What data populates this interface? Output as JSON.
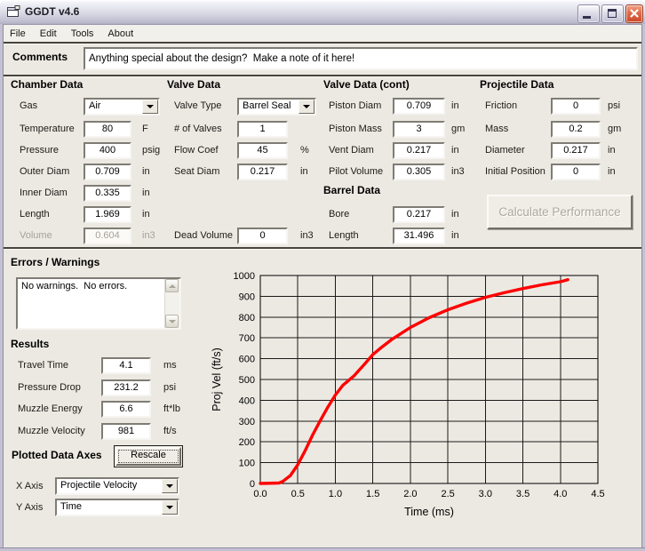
{
  "window": {
    "title": "GGDT v4.6",
    "menu": [
      "File",
      "Edit",
      "Tools",
      "About"
    ]
  },
  "comments": {
    "label": "Comments",
    "value": "Anything special about the design?  Make a note of it here!"
  },
  "columns": [
    {
      "id": "chamber-data",
      "heading": "Chamber Data",
      "fields": [
        {
          "row": 0,
          "label": "Gas",
          "type": "dropdown",
          "value": "Air",
          "unit": ""
        },
        {
          "row": 1,
          "label": "Temperature",
          "type": "text",
          "value": "80",
          "unit": "F"
        },
        {
          "row": 2,
          "label": "Pressure",
          "type": "text",
          "value": "400",
          "unit": "psig"
        },
        {
          "row": 3,
          "label": "Outer Diam",
          "type": "text",
          "value": "0.709",
          "unit": "in"
        },
        {
          "row": 4,
          "label": "Inner Diam",
          "type": "text",
          "value": "0.335",
          "unit": "in"
        },
        {
          "row": 5,
          "label": "Length",
          "type": "text",
          "value": "1.969",
          "unit": "in"
        },
        {
          "row": 6,
          "label": "Volume",
          "type": "text-disabled",
          "value": "0.604",
          "unit": "in3"
        }
      ]
    },
    {
      "id": "valve-data",
      "heading": "Valve Data",
      "fields": [
        {
          "row": 0,
          "label": "Valve Type",
          "type": "dropdown",
          "value": "Barrel Seal",
          "unit": ""
        },
        {
          "row": 1,
          "label": "# of Valves",
          "type": "text",
          "value": "1",
          "unit": ""
        },
        {
          "row": 2,
          "label": "Flow Coef",
          "type": "text",
          "value": "45",
          "unit": "%"
        },
        {
          "row": 3,
          "label": "Seat Diam",
          "type": "text",
          "value": "0.217",
          "unit": "in"
        },
        {
          "row": 6,
          "label": "Dead Volume",
          "type": "text",
          "value": "0",
          "unit": "in3"
        }
      ]
    },
    {
      "id": "valve-data-cont",
      "heading": "Valve Data (cont)",
      "subheading": "Barrel Data",
      "fields": [
        {
          "row": 0,
          "label": "Piston Diam",
          "type": "text",
          "value": "0.709",
          "unit": "in"
        },
        {
          "row": 1,
          "label": "Piston Mass",
          "type": "text",
          "value": "3",
          "unit": "gm"
        },
        {
          "row": 2,
          "label": "Vent Diam",
          "type": "text",
          "value": "0.217",
          "unit": "in"
        },
        {
          "row": 3,
          "label": "Pilot Volume",
          "type": "text",
          "value": "0.305",
          "unit": "in3"
        },
        {
          "row": 5,
          "label": "Bore",
          "type": "text",
          "value": "0.217",
          "unit": "in"
        },
        {
          "row": 6,
          "label": "Length",
          "type": "text",
          "value": "31.496",
          "unit": "in"
        }
      ]
    },
    {
      "id": "projectile-data",
      "heading": "Projectile Data",
      "button": "Calculate Performance",
      "fields": [
        {
          "row": 0,
          "label": "Friction",
          "type": "text",
          "value": "0",
          "unit": "psi"
        },
        {
          "row": 1,
          "label": "Mass",
          "type": "text",
          "value": "0.2",
          "unit": "gm"
        },
        {
          "row": 2,
          "label": "Diameter",
          "type": "text",
          "value": "0.217",
          "unit": "in"
        },
        {
          "row": 3,
          "label": "Initial Position",
          "type": "text",
          "value": "0",
          "unit": "in"
        }
      ]
    }
  ],
  "errors": {
    "heading": "Errors / Warnings",
    "text": "No warnings.  No errors."
  },
  "results": {
    "heading": "Results",
    "rows": [
      {
        "label": "Travel Time",
        "value": "4.1",
        "unit": "ms"
      },
      {
        "label": "Pressure Drop",
        "value": "231.2",
        "unit": "psi"
      },
      {
        "label": "Muzzle Energy",
        "value": "6.6",
        "unit": "ft*lb"
      },
      {
        "label": "Muzzle Velocity",
        "value": "981",
        "unit": "ft/s"
      }
    ]
  },
  "plotted_axes": {
    "heading": "Plotted Data Axes",
    "rescale_label": "Rescale",
    "x_axis": {
      "label": "X Axis",
      "value": "Projectile Velocity"
    },
    "y_axis": {
      "label": "Y Axis",
      "value": "Time"
    }
  },
  "chart_data": {
    "type": "line",
    "xlabel": "Time (ms)",
    "ylabel": "Proj Vel (ft/s)",
    "xlim": [
      0,
      4.5
    ],
    "ylim": [
      0,
      1000
    ],
    "xticks": [
      "0.0",
      "0.5",
      "1.0",
      "1.5",
      "2.0",
      "2.5",
      "3.0",
      "3.5",
      "4.0",
      "4.5"
    ],
    "yticks": [
      "0",
      "100",
      "200",
      "300",
      "400",
      "500",
      "600",
      "700",
      "800",
      "900",
      "1000"
    ],
    "grid": true,
    "legend": false,
    "series": [
      {
        "name": "Projectile Velocity",
        "color": "#FF0000",
        "x": [
          0,
          0.25,
          0.3,
          0.4,
          0.5,
          0.6,
          0.7,
          0.8,
          0.9,
          1.0,
          1.1,
          1.25,
          1.4,
          1.5,
          1.6,
          1.75,
          2.0,
          2.25,
          2.5,
          2.75,
          3.0,
          3.25,
          3.5,
          3.75,
          4.0,
          4.1
        ],
        "y": [
          0,
          2,
          10,
          38,
          90,
          160,
          235,
          303,
          367,
          425,
          472,
          518,
          578,
          620,
          650,
          692,
          750,
          797,
          835,
          867,
          895,
          917,
          937,
          955,
          970,
          980
        ]
      }
    ]
  },
  "colors": {
    "curve": "#FF0000",
    "client_bg": "#ECE9E2"
  }
}
